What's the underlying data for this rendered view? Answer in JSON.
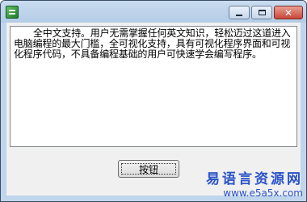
{
  "window": {
    "controls": {
      "minimize_icon": "minimize-icon",
      "maximize_icon": "maximize-icon",
      "close_icon": "close-icon",
      "close_glyph": "✕"
    }
  },
  "content": {
    "text": "全中文支持。用户无需掌握任何英文知识，轻松迈过这道进入电脑编程的最大门槛，全可视化支持，具有可视化程序界面和可视化程序代码，不具备编程基础的用户可快速学会编写程序。"
  },
  "button": {
    "label": "按钮"
  },
  "watermark": {
    "name": "易语言资源网",
    "url": "www.e5a5x.com"
  },
  "colors": {
    "frame": "#bfd5ec",
    "client": "#f0f0f0",
    "watermark": "#2a52c8"
  }
}
